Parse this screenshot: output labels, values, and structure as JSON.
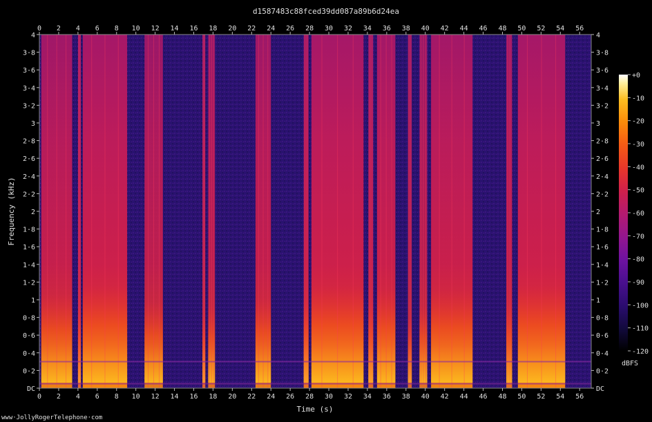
{
  "chart_data": {
    "type": "heatmap",
    "title": "d1587483c88fced39dd087a89b6d24ea",
    "xlabel": "Time (s)",
    "ylabel": "Frequency (kHz)",
    "xlim": [
      0,
      57.2
    ],
    "ylim": [
      0,
      4
    ],
    "x_ticks": [
      "0",
      "2",
      "4",
      "6",
      "8",
      "10",
      "12",
      "14",
      "16",
      "18",
      "20",
      "22",
      "24",
      "26",
      "28",
      "30",
      "32",
      "34",
      "36",
      "38",
      "40",
      "42",
      "44",
      "46",
      "48",
      "50",
      "52",
      "54",
      "56"
    ],
    "x_tick_values": [
      0,
      2,
      4,
      6,
      8,
      10,
      12,
      14,
      16,
      18,
      20,
      22,
      24,
      26,
      28,
      30,
      32,
      34,
      36,
      38,
      40,
      42,
      44,
      46,
      48,
      50,
      52,
      54,
      56
    ],
    "y_ticks": [
      "DC",
      "0·2",
      "0·4",
      "0·6",
      "0·8",
      "1",
      "1·2",
      "1·4",
      "1·6",
      "1·8",
      "2",
      "2·2",
      "2·4",
      "2·6",
      "2·8",
      "3",
      "3·2",
      "3·4",
      "3·6",
      "3·8",
      "4"
    ],
    "y_tick_values": [
      0,
      0.2,
      0.4,
      0.6,
      0.8,
      1.0,
      1.2,
      1.4,
      1.6,
      1.8,
      2.0,
      2.2,
      2.4,
      2.6,
      2.8,
      3.0,
      3.2,
      3.4,
      3.6,
      3.8,
      4.0
    ],
    "colorbar": {
      "label": "dBFS",
      "ticks": [
        "+0",
        "-10",
        "-20",
        "-30",
        "-40",
        "-50",
        "-60",
        "-70",
        "-80",
        "-90",
        "-100",
        "-110",
        "-120"
      ],
      "tick_values": [
        0,
        -10,
        -20,
        -30,
        -40,
        -50,
        -60,
        -70,
        -80,
        -90,
        -100,
        -110,
        -120
      ],
      "range": [
        -120,
        0
      ],
      "colormap": [
        "#000000",
        "#120a3c",
        "#2a0c6e",
        "#4a0f8f",
        "#6e12a0",
        "#92168f",
        "#b41a6e",
        "#d0204a",
        "#e8362a",
        "#f55d14",
        "#fb8c0a",
        "#fdbd20",
        "#fff0a0",
        "#ffffff"
      ]
    },
    "background_color": "#28146e",
    "segments": [
      {
        "start": 0.2,
        "end": 3.4,
        "level": 0.85
      },
      {
        "start": 4.0,
        "end": 4.3,
        "level": 0.7
      },
      {
        "start": 4.5,
        "end": 9.1,
        "level": 0.95
      },
      {
        "start": 10.9,
        "end": 12.8,
        "level": 0.75
      },
      {
        "start": 16.9,
        "end": 17.2,
        "level": 0.6
      },
      {
        "start": 17.5,
        "end": 18.2,
        "level": 0.7
      },
      {
        "start": 22.4,
        "end": 24.0,
        "level": 0.8
      },
      {
        "start": 27.4,
        "end": 27.9,
        "level": 0.8
      },
      {
        "start": 28.2,
        "end": 33.6,
        "level": 0.95
      },
      {
        "start": 34.1,
        "end": 34.6,
        "level": 0.75
      },
      {
        "start": 35.0,
        "end": 36.9,
        "level": 0.9
      },
      {
        "start": 38.2,
        "end": 38.6,
        "level": 0.55
      },
      {
        "start": 39.4,
        "end": 40.2,
        "level": 0.7
      },
      {
        "start": 40.6,
        "end": 44.9,
        "level": 0.9
      },
      {
        "start": 48.4,
        "end": 49.0,
        "level": 0.75
      },
      {
        "start": 49.6,
        "end": 54.5,
        "level": 0.95
      }
    ],
    "credit": "www·JollyRogerTelephone·com"
  }
}
